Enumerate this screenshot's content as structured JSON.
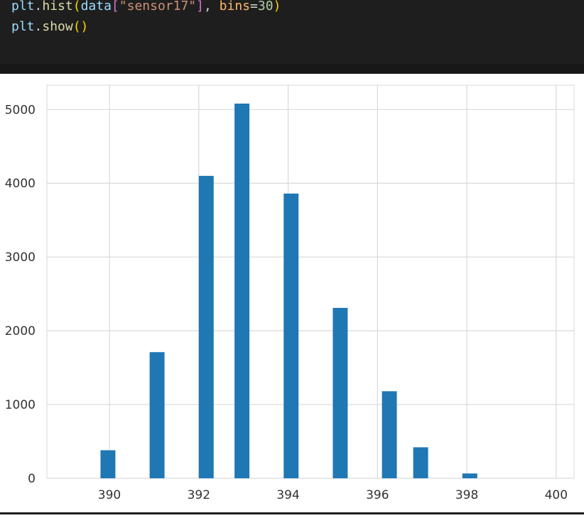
{
  "code": {
    "line1": {
      "obj": "plt",
      "dot": ".",
      "func": "hist",
      "open": "(",
      "var": "data",
      "bopen": "[",
      "str": "\"sensor17\"",
      "bclose": "]",
      "comma": ", ",
      "kw": "bins",
      "eq": "=",
      "num": "30",
      "close": ")"
    },
    "line2": {
      "obj": "plt",
      "dot": ".",
      "func": "show",
      "parens": "()"
    }
  },
  "colors": {
    "editor_bg": "#1e1e1e",
    "token_variable": "#9cdcfe",
    "token_function": "#dcdcaa",
    "token_string": "#ce9178",
    "token_keyword_arg": "#ffb86c",
    "token_number": "#b5cea8",
    "token_punct": "#d4d4d4",
    "token_paren": "#ffd700",
    "token_bracket": "#da70d6",
    "bar_fill": "#1f77b4",
    "grid": "#d9d9d9"
  },
  "chart_data": {
    "type": "bar",
    "title": "",
    "xlabel": "",
    "ylabel": "",
    "xlim": [
      388.6,
      400.4
    ],
    "ylim": [
      0,
      5330
    ],
    "xticks": [
      390,
      392,
      394,
      396,
      398,
      400
    ],
    "xtick_labels": [
      "390",
      "392",
      "394",
      "396",
      "398",
      "400"
    ],
    "yticks": [
      0,
      1000,
      2000,
      3000,
      4000,
      5000
    ],
    "ytick_labels": [
      "0",
      "1000",
      "2000",
      "3000",
      "4000",
      "5000"
    ],
    "grid": true,
    "bin_width": 0.3333,
    "bins": [
      {
        "x": 389.8,
        "value": 380
      },
      {
        "x": 390.9,
        "value": 1710
      },
      {
        "x": 392.0,
        "value": 4100
      },
      {
        "x": 392.8,
        "value": 5080
      },
      {
        "x": 393.9,
        "value": 3860
      },
      {
        "x": 395.0,
        "value": 2310
      },
      {
        "x": 396.1,
        "value": 1180
      },
      {
        "x": 396.8,
        "value": 420
      },
      {
        "x": 397.9,
        "value": 65
      }
    ]
  }
}
